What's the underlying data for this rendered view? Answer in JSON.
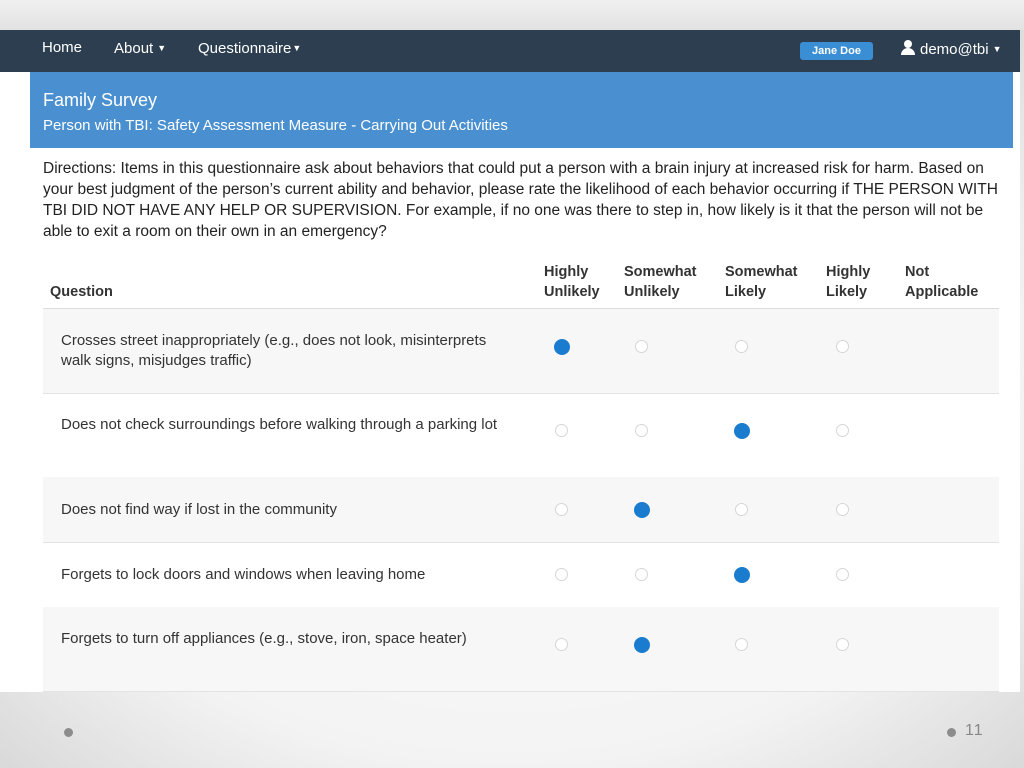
{
  "nav": {
    "home": "Home",
    "about": "About",
    "questionnaire": "Questionnaire",
    "user_badge": "Jane Doe",
    "account": "demo@tbi"
  },
  "panel": {
    "title": "Family Survey",
    "subtitle": "Person with TBI: Safety Assessment Measure - Carrying Out Activities"
  },
  "directions": "Directions: Items in this questionnaire ask about behaviors that could put a person with a brain injury at increased risk for harm. Based on your best judgment of the person’s current ability and behavior, please rate the likelihood of each behavior occurring if THE PERSON WITH TBI DID NOT HAVE ANY HELP OR SUPERVISION. For example, if no one was there to step in, how likely is it that the person will not be able to exit a room on their own in an emergency?",
  "table": {
    "question_header": "Question",
    "columns": [
      {
        "line1": "Highly",
        "line2": "Unlikely"
      },
      {
        "line1": "Somewhat",
        "line2": "Unlikely"
      },
      {
        "line1": "Somewhat",
        "line2": "Likely"
      },
      {
        "line1": "Highly",
        "line2": "Likely"
      },
      {
        "line1": "Not",
        "line2": "Applicable"
      }
    ],
    "rows": [
      {
        "question": "Crosses street inappropriately (e.g., does not look, misinterprets walk signs, misjudges traffic)",
        "selected": "Highly Unlikely"
      },
      {
        "question": "Does not check surroundings before walking through a parking lot",
        "selected": "Somewhat Likely"
      },
      {
        "question": "Does not find way if lost in the community",
        "selected": "Somewhat Unlikely"
      },
      {
        "question": "Forgets to lock doors and windows when leaving home",
        "selected": "Somewhat Likely"
      },
      {
        "question": "Forgets to turn off appliances (e.g., stove, iron, space heater)",
        "selected": "Somewhat Unlikely"
      }
    ]
  },
  "slide_number": "11",
  "colors": {
    "navbar": "#2c3e50",
    "panel_header": "#4a90d0",
    "selected_radio": "#1a7ccf"
  }
}
